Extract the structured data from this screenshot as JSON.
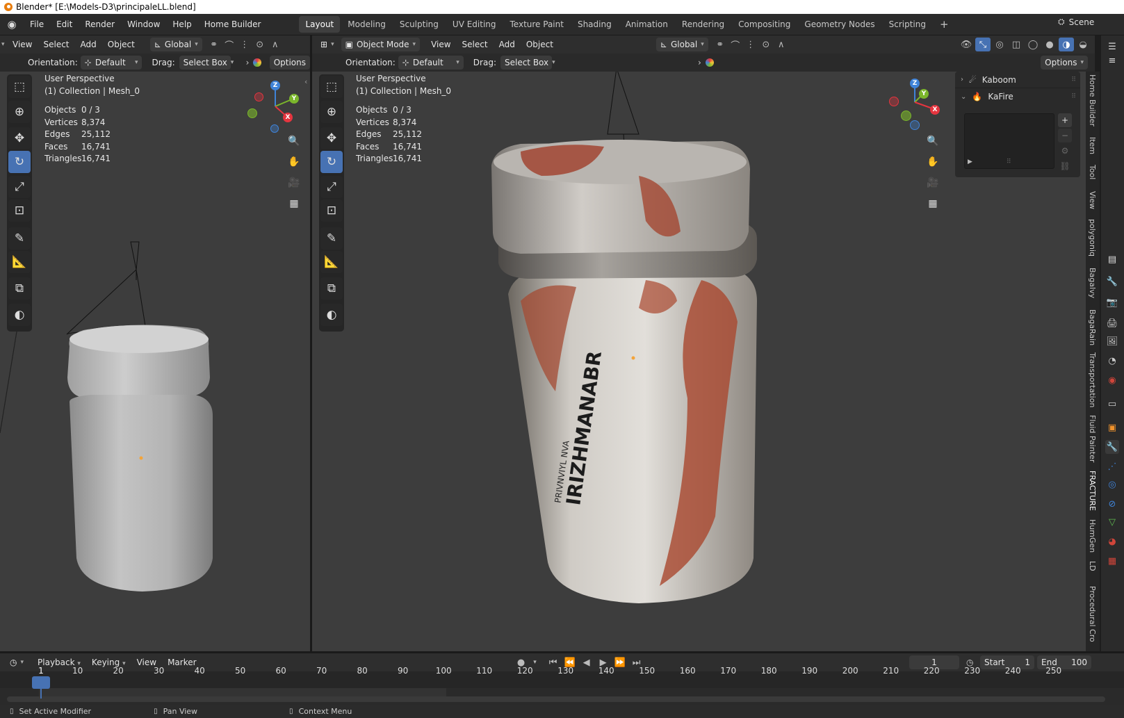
{
  "window": {
    "title": "Blender* [E:\\Models-D3\\principaleLL.blend]"
  },
  "menu": [
    "File",
    "Edit",
    "Render",
    "Window",
    "Help",
    "Home Builder"
  ],
  "workspaces": [
    "Layout",
    "Modeling",
    "Sculpting",
    "UV Editing",
    "Texture Paint",
    "Shading",
    "Animation",
    "Rendering",
    "Compositing",
    "Geometry Nodes",
    "Scripting"
  ],
  "scene": "Scene",
  "left_view": {
    "menus": [
      "View",
      "Select",
      "Add",
      "Object"
    ],
    "transform": "Global",
    "orientation_label": "Orientation:",
    "orientation": "Default",
    "drag_label": "Drag:",
    "drag": "Select Box",
    "options": "Options",
    "perspective": "User Perspective",
    "collection": "(1) Collection | Mesh_0"
  },
  "right_view": {
    "mode": "Object Mode",
    "menus": [
      "View",
      "Select",
      "Add",
      "Object"
    ],
    "transform": "Global",
    "orientation_label": "Orientation:",
    "orientation": "Default",
    "drag_label": "Drag:",
    "drag": "Select Box",
    "options": "Options",
    "perspective": "User Perspective",
    "collection": "(1) Collection | Mesh_0"
  },
  "stats": [
    {
      "k": "Objects",
      "v": "0 / 3"
    },
    {
      "k": "Vertices",
      "v": "8,374"
    },
    {
      "k": "Edges",
      "v": "25,112"
    },
    {
      "k": "Faces",
      "v": "16,741"
    },
    {
      "k": "Triangles",
      "v": "16,741"
    }
  ],
  "side_panel": {
    "items": [
      "Kaboom",
      "KaFire"
    ]
  },
  "sidebar_tabs": [
    "Home Builder",
    "Item",
    "Tool",
    "View",
    "polygoniq",
    "Bagalvy",
    "BagaRain",
    "Transportation",
    "Fluid Painter",
    "FRACTURE",
    "HumGen",
    "LD",
    "Procedural Cro"
  ],
  "timeline": {
    "menus": [
      "Playback",
      "Keying",
      "View",
      "Marker"
    ],
    "current_frame": "1",
    "start_label": "Start",
    "start": "1",
    "end_label": "End",
    "end": "100",
    "ruler": [
      "1",
      "10",
      "20",
      "30",
      "40",
      "50",
      "60",
      "70",
      "80",
      "90",
      "100",
      "110",
      "120",
      "130",
      "140",
      "150",
      "160",
      "170",
      "180",
      "190",
      "200",
      "210",
      "220",
      "230",
      "240",
      "250"
    ]
  },
  "statusbar": [
    "Set Active Modifier",
    "Pan View",
    "Context Menu"
  ],
  "label_text": {
    "line1": "IRIZHMANABR",
    "line2": "PRIVNVIYL NVA"
  },
  "colors": {
    "accent": "#4772b3",
    "x_axis": "#e5353f",
    "y_axis": "#7bb62b",
    "z_axis": "#3f83d8"
  }
}
